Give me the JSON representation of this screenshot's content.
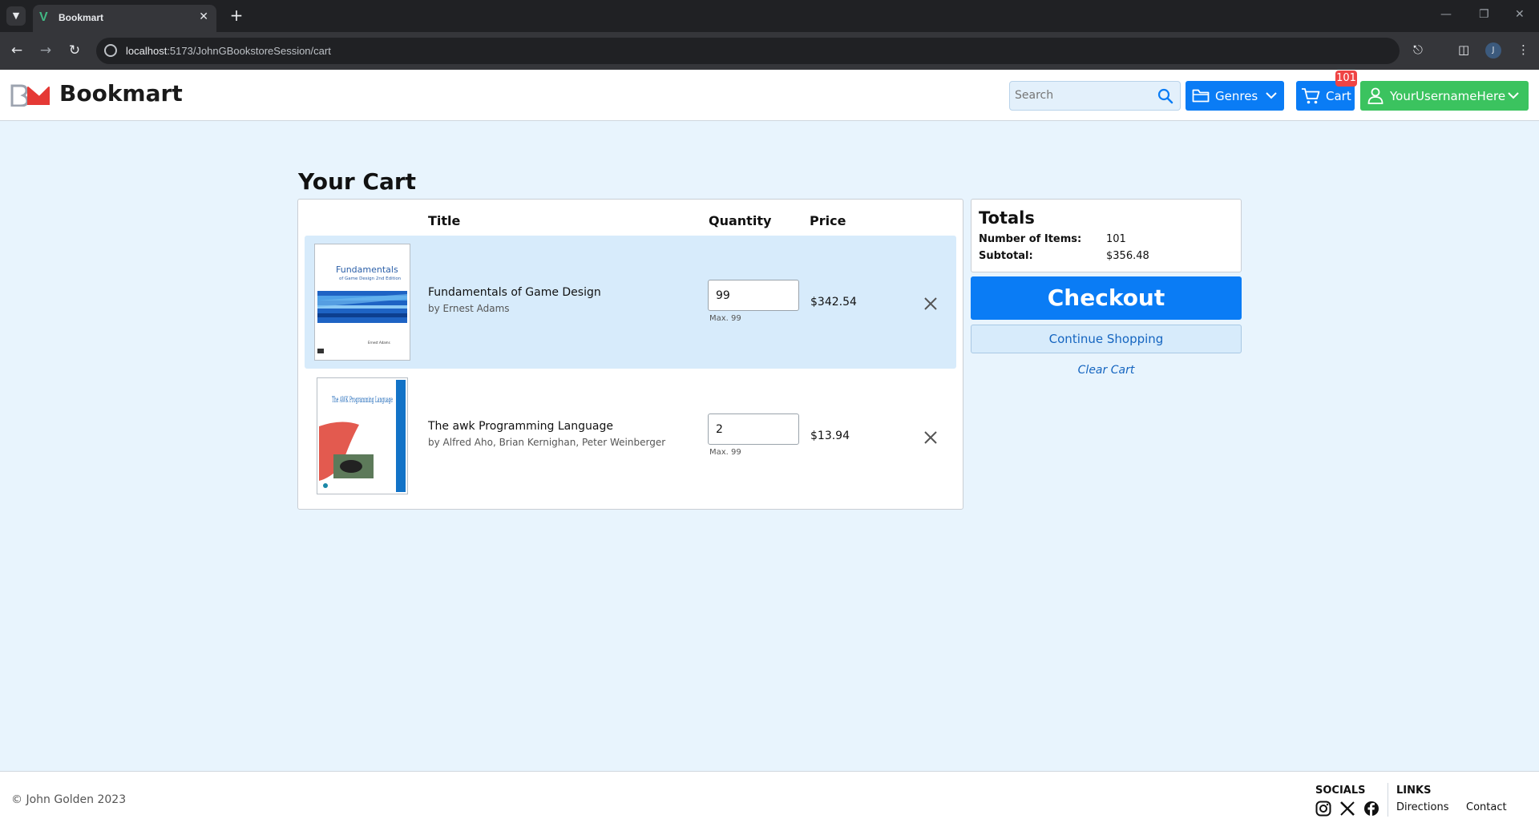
{
  "browser": {
    "tab_title": "Bookmart",
    "url_host": "localhost",
    "url_path": ":5173/JohnGBookstoreSession/cart",
    "profile_initial": "J"
  },
  "header": {
    "brand": "Bookmart",
    "search_placeholder": "Search",
    "genres_label": "Genres",
    "cart_label": "Cart",
    "cart_badge": "101",
    "user_label": "YourUsernameHere"
  },
  "cart": {
    "title": "Your Cart",
    "columns": {
      "title": "Title",
      "quantity": "Quantity",
      "price": "Price"
    },
    "items": [
      {
        "title": "Fundamentals of Game Design",
        "author": "by Ernest Adams",
        "quantity": "99",
        "max": "Max. 99",
        "price": "$342.54",
        "cover_text": "Fundamentals",
        "cover_subtext": "of Game Design 2nd Edition"
      },
      {
        "title": "The awk Programming Language",
        "author": "by Alfred Aho, Brian Kernighan, Peter Weinberger",
        "quantity": "2",
        "max": "Max. 99",
        "price": "$13.94",
        "cover_text": "The AWK Programming Language"
      }
    ]
  },
  "totals": {
    "title": "Totals",
    "items_label": "Number of Items:",
    "items_value": "101",
    "subtotal_label": "Subtotal:",
    "subtotal_value": "$356.48",
    "checkout_label": "Checkout",
    "continue_label": "Continue Shopping",
    "clear_label": "Clear Cart"
  },
  "footer": {
    "copyright": "© John Golden 2023",
    "socials_title": "SOCIALS",
    "links_title": "LINKS",
    "links": [
      "Directions",
      "Contact"
    ]
  },
  "colors": {
    "primary": "#0a7cf5",
    "user_green": "#3bc35f",
    "badge_red": "#ef4444",
    "page_bg": "#e8f4fd",
    "row_highlight": "#d7ebfb"
  }
}
